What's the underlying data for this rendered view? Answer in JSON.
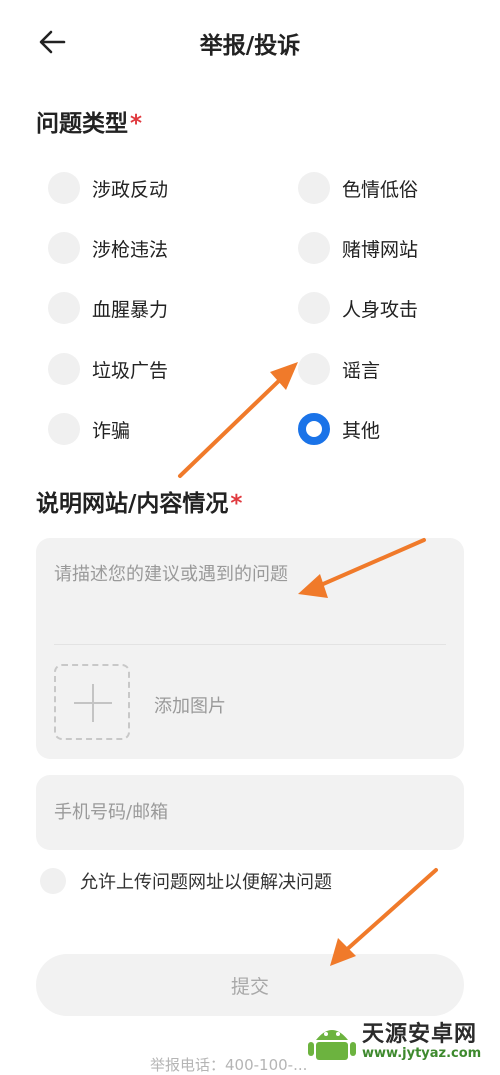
{
  "header": {
    "title": "举报/投诉"
  },
  "problem_type": {
    "label": "问题类型",
    "required_mark": "*",
    "options": [
      {
        "label": "涉政反动",
        "checked": false
      },
      {
        "label": "色情低俗",
        "checked": false
      },
      {
        "label": "涉枪违法",
        "checked": false
      },
      {
        "label": "赌博网站",
        "checked": false
      },
      {
        "label": "血腥暴力",
        "checked": false
      },
      {
        "label": "人身攻击",
        "checked": false
      },
      {
        "label": "垃圾广告",
        "checked": false
      },
      {
        "label": "谣言",
        "checked": false
      },
      {
        "label": "诈骗",
        "checked": false
      },
      {
        "label": "其他",
        "checked": true
      }
    ]
  },
  "description": {
    "label": "说明网站/内容情况",
    "required_mark": "*",
    "placeholder": "请描述您的建议或遇到的问题",
    "add_image_label": "添加图片"
  },
  "contact": {
    "placeholder": "手机号码/邮箱"
  },
  "allow_upload": {
    "label": "允许上传问题网址以便解决问题"
  },
  "submit": {
    "label": "提交"
  },
  "footer": {
    "note": "举报电话：400-100-..."
  },
  "watermark": {
    "name": "天源安卓网",
    "url": "www.jytyaz.com"
  },
  "colors": {
    "accent": "#1a73e8",
    "required": "#e0393e",
    "annotation_arrow": "#f07a2a",
    "input_bg": "#f2f2f2"
  }
}
